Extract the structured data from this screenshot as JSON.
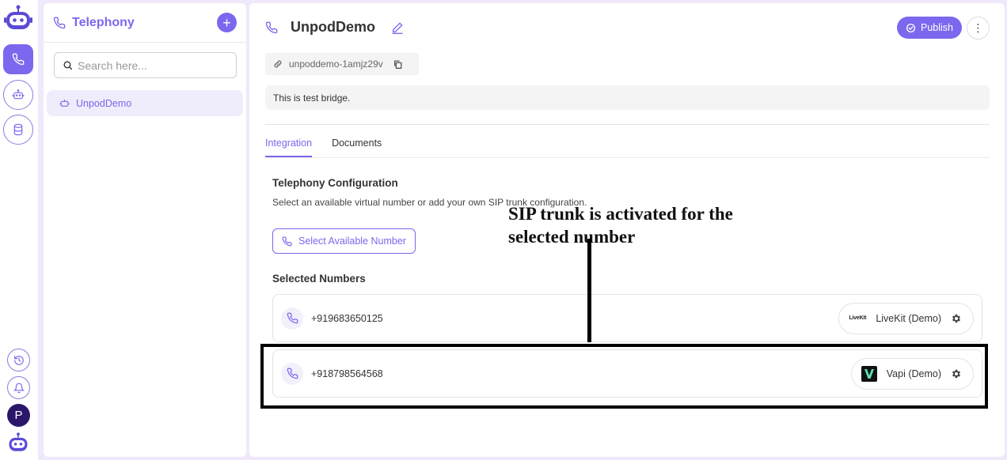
{
  "sidebar": {
    "title": "Telephony",
    "add_label": "+",
    "search_placeholder": "Search here...",
    "items": [
      {
        "label": "UnpodDemo"
      }
    ]
  },
  "rail": {
    "avatar_letter": "P"
  },
  "main": {
    "title": "UnpodDemo",
    "publish_label": "Publish",
    "more_label": "⋮",
    "slug": "unpoddemo-1amjz29v",
    "description": "This is test bridge.",
    "tabs": [
      {
        "label": "Integration",
        "active": true
      },
      {
        "label": "Documents",
        "active": false
      }
    ],
    "section_title": "Telephony Configuration",
    "section_desc": "Select an available virtual number or add your own SIP trunk configuration.",
    "select_button": "Select Available Number",
    "selected_title": "Selected Numbers",
    "numbers": [
      {
        "number": "+919683650125",
        "provider": "LiveKit (Demo)",
        "logo_text": "LiveKit"
      },
      {
        "number": "+918798564568",
        "provider": "Vapi (Demo)"
      }
    ]
  },
  "annotation": {
    "text": "SIP trunk is activated for the selected number"
  },
  "colors": {
    "accent": "#7b68ee",
    "background": "#f0e8fb",
    "vapi_green": "#5de0b0"
  }
}
